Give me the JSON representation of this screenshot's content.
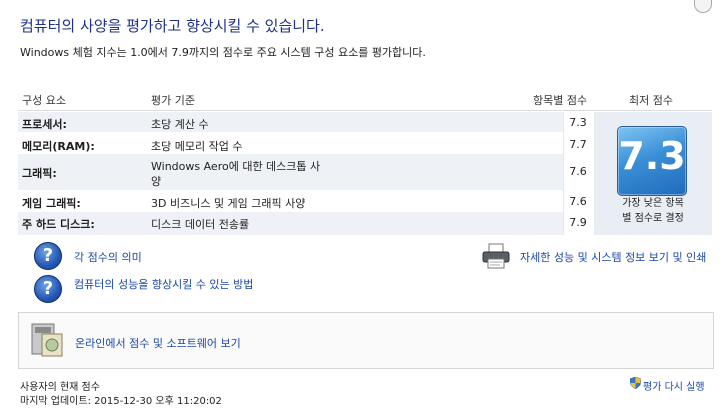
{
  "header": {
    "title": "컴퓨터의 사양을 평가하고 향상시킬 수 있습니다.",
    "subtitle": "Windows 체험 지수는 1.0에서 7.9까지의 점수로 주요 시스템 구성 요소를 평가합니다."
  },
  "table": {
    "columns": {
      "component": "구성 요소",
      "criteria": "평가 기준",
      "subscore": "항목별 점수",
      "basescore": "최저 점수"
    },
    "rows": [
      {
        "component": "프로세서:",
        "criteria": "초당 계산 수",
        "score": "7.3"
      },
      {
        "component": "메모리(RAM):",
        "criteria": "초당 메모리 작업 수",
        "score": "7.7"
      },
      {
        "component": "그래픽:",
        "criteria_line1": "Windows Aero에 대한 데스크톱 사",
        "criteria_line2": "양",
        "score": "7.6"
      },
      {
        "component": "게임 그래픽:",
        "criteria": "3D 비즈니스 및 게임 그래픽 사양",
        "score": "7.6"
      },
      {
        "component": "주 하드 디스크:",
        "criteria": "디스크 데이터 전송률",
        "score": "7.9"
      }
    ],
    "base_score": "7.3",
    "base_caption_line1": "가장 낮은 항목",
    "base_caption_line2": "별 점수로 결정"
  },
  "links": {
    "meaning": "각 점수의 의미",
    "improve": "컴퓨터의 성능을 향상시킬 수 있는 방법",
    "details": "자세한 성능 및 시스템 정보 보기 및 인쇄",
    "online": "온라인에서 점수 및 소프트웨어 보기"
  },
  "footer": {
    "current_score_label": "사용자의 현재 점수",
    "last_update": "마지막 업데이트: 2015-12-30 오후 11:20:02",
    "rerun": "평가 다시 실행"
  },
  "icons": {
    "help": "question-circle-icon",
    "printer": "printer-icon",
    "pc": "computer-software-icon",
    "shield": "uac-shield-icon"
  },
  "colors": {
    "title": "#1e3287",
    "link": "#1a48a8",
    "badge": "#3a8fd6",
    "row_band": "#eef2f7"
  }
}
